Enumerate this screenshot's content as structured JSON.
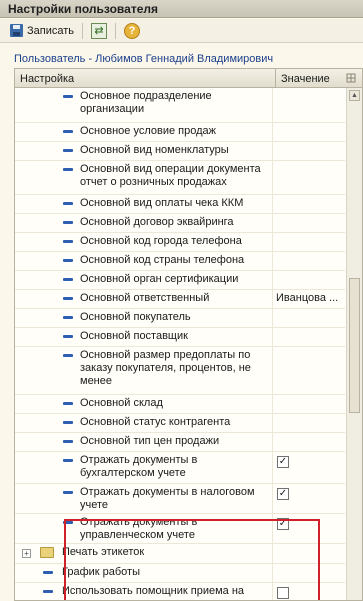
{
  "window": {
    "title": "Настройки пользователя"
  },
  "toolbar": {
    "save_label": "Записать"
  },
  "user_line": "Пользователь - Любимов Геннадий Владимирович",
  "grid": {
    "header": {
      "setting": "Настройка",
      "value": "Значение"
    },
    "rows": [
      {
        "label": "Основное подразделение организации",
        "value": ""
      },
      {
        "label": "Основное условие продаж",
        "value": ""
      },
      {
        "label": "Основной вид номенклатуры",
        "value": ""
      },
      {
        "label": "Основной вид операции документа отчет о розничных продажах",
        "value": ""
      },
      {
        "label": "Основной вид оплаты чека ККМ",
        "value": ""
      },
      {
        "label": "Основной договор эквайринга",
        "value": ""
      },
      {
        "label": "Основной код города телефона",
        "value": ""
      },
      {
        "label": "Основной код страны телефона",
        "value": ""
      },
      {
        "label": "Основной орган сертификации",
        "value": ""
      },
      {
        "label": "Основной ответственный",
        "value": "Иванцова ..."
      },
      {
        "label": "Основной покупатель",
        "value": ""
      },
      {
        "label": "Основной поставщик",
        "value": ""
      },
      {
        "label": "Основной размер предоплаты по заказу покупателя, процентов, не менее",
        "value": ""
      },
      {
        "label": "Основной склад",
        "value": ""
      },
      {
        "label": "Основной статус контрагента",
        "value": ""
      },
      {
        "label": "Основной тип цен продажи",
        "value": ""
      },
      {
        "label": "Отражать документы в бухгалтерском учете",
        "checked": true
      },
      {
        "label": "Отражать документы в налоговом учете",
        "checked": true
      },
      {
        "label": "Отражать документы в управленческом учете",
        "checked": true
      },
      {
        "label": "Печать этикеток",
        "group": true
      },
      {
        "label": "График работы",
        "value": ""
      },
      {
        "label": "Использовать помощник приема на",
        "checked": false
      }
    ]
  },
  "icons": {
    "save": "save-icon",
    "refresh": "refresh-icon",
    "help": "help-icon"
  },
  "colors": {
    "highlight": "#d0202a",
    "user_text": "#1c3f8c",
    "mark": "#2f5fb0"
  }
}
